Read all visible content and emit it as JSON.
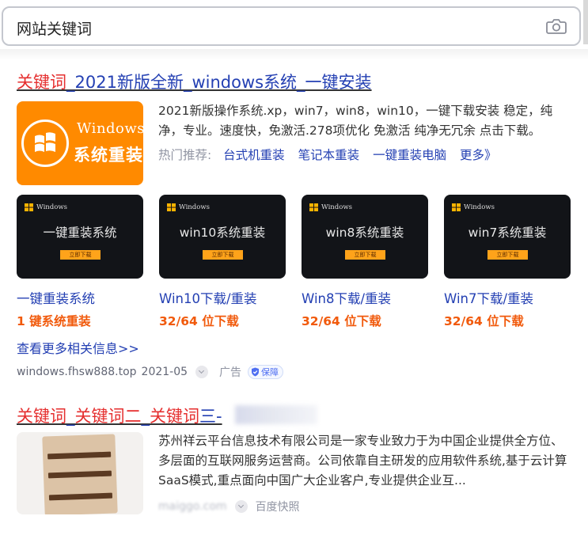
{
  "search": {
    "query": "网站关键词",
    "camera_icon": "camera-icon"
  },
  "result1": {
    "title_kw": "关键词",
    "title_rest": "_2021新版全新_windows系统_一键安装",
    "logo_line1": "Windows",
    "logo_line2": "系统重装",
    "desc": "2021新版操作系统.xp，win7，win8，win10，一键下载安装 稳定，纯净，专业。速度快，免激活.278项优化 免激活 纯净无冗余 点击下载。",
    "hot_label": "热门推荐:",
    "hot_links": [
      "台式机重装",
      "笔记本重装",
      "一键重装电脑",
      "更多》"
    ],
    "cards": [
      {
        "badge": "Windows",
        "title": "一键重装系统",
        "button": "立即下载",
        "name": "一键重装系统",
        "sub": "1 键系统重装"
      },
      {
        "badge": "Windows",
        "title": "win10系统重装",
        "button": "立即下载",
        "name": "Win10下载/重装",
        "sub": "32/64 位下载"
      },
      {
        "badge": "Windows",
        "title": "win8系统重装",
        "button": "立即下载",
        "name": "Win8下载/重装",
        "sub": "32/64 位下载"
      },
      {
        "badge": "Windows",
        "title": "win7系统重装",
        "button": "立即下载",
        "name": "Win7下载/重装",
        "sub": "32/64 位下载"
      }
    ],
    "more": "查看更多相关信息>>",
    "source": "windows.fhsw888.top",
    "date": "2021-05",
    "ad_label": "广告",
    "guarantee": "保障"
  },
  "result2": {
    "title_kw1": "关键词",
    "title_sep1": "_",
    "title_kw2": "关键词二",
    "title_sep2": "_",
    "title_kw3": "关键词",
    "title_rest": "三-",
    "desc": "苏州祥云平台信息技术有限公司是一家专业致力于为中国企业提供全方位、多层面的互联网服务运营商。公司依靠自主研发的应用软件系统,基于云计算SaaS模式,重点面向中国广大企业客户,专业提供企业互...",
    "source_blurred": "maiggo.com",
    "snapshot": "百度快照"
  },
  "colors": {
    "link": "#2440b3",
    "highlight": "#e52e2e",
    "orange": "#ff8a00",
    "accent_orange": "#f15a0c"
  }
}
